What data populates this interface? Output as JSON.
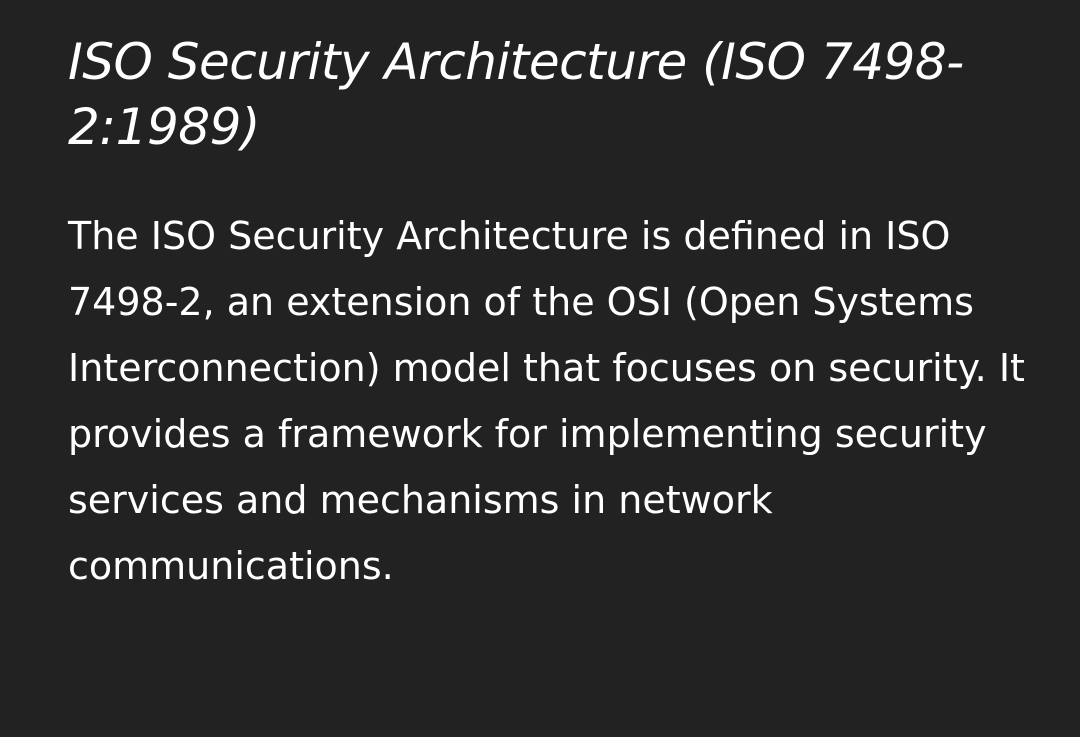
{
  "article": {
    "title": "ISO Security Architecture (ISO 7498-2:1989)",
    "paragraph": "The ISO Security Architecture is defined in ISO 7498-2, an extension of the OSI (Open Systems Interconnection) model that focuses on security. It provides a framework for implementing security services and mechanisms in network communications."
  },
  "colors": {
    "background": "#222222",
    "text": "#ffffff"
  }
}
